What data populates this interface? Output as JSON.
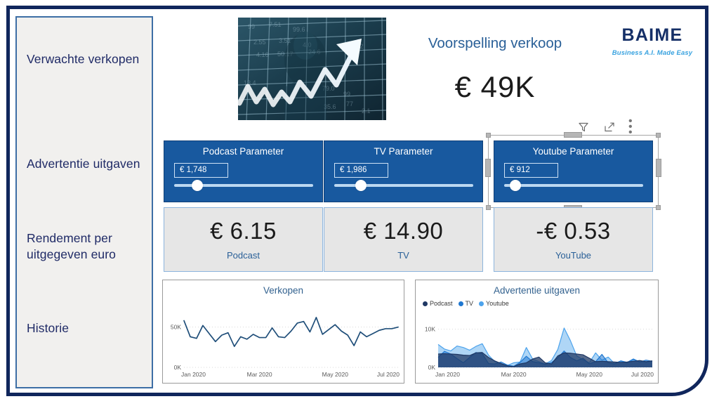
{
  "frame": {
    "accent_navy": "#10265c",
    "panel_bg": "#f1f0ee",
    "panel_border": "#3d6ea5"
  },
  "sidebar": {
    "items": [
      {
        "label": "Verwachte verkopen"
      },
      {
        "label": "Advertentie uitgaven"
      },
      {
        "label": "Rendement per uitgegeven euro"
      },
      {
        "label": "Historie"
      }
    ]
  },
  "header": {
    "title": "Voorspelling verkoop",
    "value": "€ 49K",
    "hero_image_name": "stock-market-arrow-image",
    "logo": {
      "name": "BAIME",
      "tagline": "Business A.I. Made Easy",
      "color": "#152f67",
      "tagline_color": "#3aa3e0"
    }
  },
  "toolbar": {
    "filter_label": "Filters",
    "focus_label": "Focus mode",
    "more_label": "More options",
    "more_glyph": "• • •"
  },
  "parameters": {
    "cards": [
      {
        "title": "Podcast Parameter",
        "value": "€ 1,748",
        "slider_percent": 17,
        "selected": false
      },
      {
        "title": "TV Parameter",
        "value": "€ 1,986",
        "slider_percent": 20,
        "selected": false
      },
      {
        "title": "Youtube Parameter",
        "value": "€ 912",
        "slider_percent": 9,
        "selected": true
      }
    ],
    "accent_color": "#18599f"
  },
  "kpis": {
    "cards": [
      {
        "value": "€ 6.15",
        "label": "Podcast"
      },
      {
        "value": "€ 14.90",
        "label": "TV"
      },
      {
        "value": "-€ 0.53",
        "label": "YouTube"
      }
    ]
  },
  "charts": {
    "sales": {
      "title": "Verkopen",
      "y_ticks": [
        "50K",
        "0K"
      ],
      "x_ticks": [
        "Jan 2020",
        "Mar 2020",
        "May 2020",
        "Jul 2020"
      ]
    },
    "spend": {
      "title": "Advertentie uitgaven",
      "y_ticks": [
        "10K",
        "0K"
      ],
      "x_ticks": [
        "Jan 2020",
        "Mar 2020",
        "May 2020",
        "Jul 2020"
      ],
      "legend": [
        {
          "label": "Podcast",
          "color": "#1f3864"
        },
        {
          "label": "TV",
          "color": "#1f77d0"
        },
        {
          "label": "Youtube",
          "color": "#4da3ec"
        }
      ]
    }
  },
  "chart_data": [
    {
      "type": "line",
      "title": "Verkopen",
      "xlabel": "",
      "ylabel": "",
      "ylim": [
        0,
        75000
      ],
      "y_tick_values": [
        0,
        50000
      ],
      "y_tick_labels": [
        "0K",
        "50K"
      ],
      "x_tick_labels": [
        "Jan 2020",
        "Mar 2020",
        "May 2020",
        "Jul 2020"
      ],
      "x_tick_positions": [
        0,
        12,
        24,
        35
      ],
      "grid": true,
      "legend": "none",
      "series": [
        {
          "name": "Verkopen",
          "color": "#1f4e79",
          "values": [
            58000,
            38000,
            36000,
            52000,
            42000,
            32000,
            40000,
            43000,
            26000,
            38000,
            35000,
            41000,
            37000,
            37000,
            49000,
            38000,
            37000,
            45000,
            55000,
            57000,
            44000,
            62000,
            41000,
            47000,
            53000,
            45000,
            40000,
            27000,
            44000,
            38000,
            42000,
            46000,
            48000,
            48000,
            50000
          ]
        }
      ]
    },
    {
      "type": "area",
      "title": "Advertentie uitgaven",
      "xlabel": "",
      "ylabel": "",
      "ylim": [
        0,
        12500
      ],
      "y_tick_values": [
        0,
        10000
      ],
      "y_tick_labels": [
        "0K",
        "10K"
      ],
      "x_tick_labels": [
        "Jan 2020",
        "Mar 2020",
        "May 2020",
        "Jul 2020"
      ],
      "x_tick_positions": [
        0,
        12,
        24,
        35
      ],
      "grid": true,
      "legend": "top-left",
      "series": [
        {
          "name": "Podcast",
          "color": "#1f3864",
          "values": [
            3500,
            3600,
            3500,
            3400,
            3200,
            3100,
            3800,
            3900,
            2600,
            1700,
            1000,
            400,
            200,
            900,
            1200,
            2200,
            2700,
            1200,
            900,
            3000,
            3800,
            3700,
            3500,
            3300,
            2400,
            1500,
            1600,
            1500,
            1400,
            1300,
            1400,
            1600,
            1800,
            1500,
            1700
          ]
        },
        {
          "name": "TV",
          "color": "#1f77d0",
          "values": [
            2600,
            4200,
            3500,
            2300,
            1200,
            2600,
            3900,
            3600,
            1000,
            900,
            1400,
            600,
            300,
            1300,
            2900,
            1500,
            1200,
            800,
            1300,
            2500,
            4300,
            2600,
            1700,
            2400,
            900,
            1500,
            3400,
            1200,
            900,
            1700,
            1300,
            2200,
            1400,
            1900,
            1600
          ]
        },
        {
          "name": "Youtube",
          "color": "#4da3ec",
          "values": [
            6000,
            4800,
            4300,
            5600,
            5200,
            4500,
            5500,
            6200,
            3200,
            1500,
            1000,
            500,
            1200,
            1400,
            5200,
            2200,
            1500,
            900,
            1800,
            4700,
            10300,
            7000,
            3000,
            2000,
            1200,
            3800,
            1900,
            2700,
            1000,
            1700,
            1100,
            2100,
            1500,
            1300,
            1700
          ]
        }
      ]
    }
  ]
}
